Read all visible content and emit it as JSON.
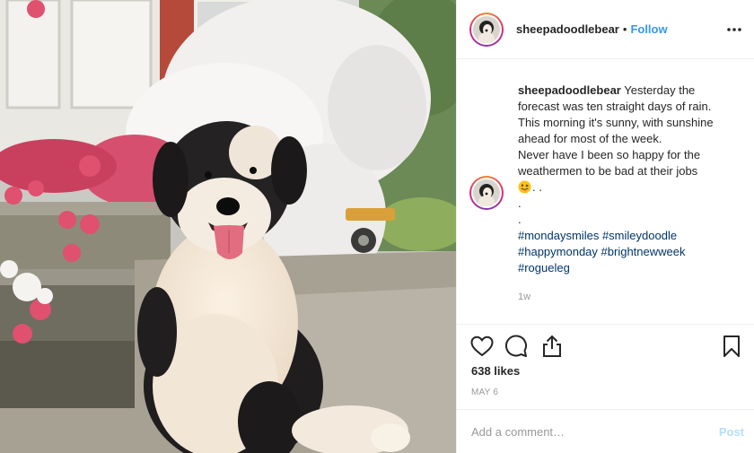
{
  "photo": {
    "alt_icon": "dog-photo"
  },
  "header": {
    "username": "sheepadoodlebear",
    "separator": "•",
    "follow_label": "Follow",
    "more_icon": "more-horizontal-icon"
  },
  "caption": {
    "username": "sheepadoodlebear",
    "lines": [
      " Yesterday the",
      "forecast was ten straight days of rain.",
      "This morning it's sunny, with sunshine",
      "ahead for most of the week.",
      "Never have I been so happy for the",
      "weathermen to be bad at their jobs"
    ],
    "emoji_suffix": ". .",
    "dots": [
      ".",
      "."
    ],
    "hashtags_line1": [
      "#mondaysmiles",
      "#smileydoodle"
    ],
    "hashtags_line2": [
      "#happymonday",
      "#brightnewweek"
    ],
    "hashtags_line3": [
      "#rogueleg"
    ],
    "time": "1w"
  },
  "actions": {
    "icons": [
      "heart-icon",
      "comment-icon",
      "share-icon",
      "bookmark-icon"
    ],
    "likes": "638 likes",
    "date": "MAY 6"
  },
  "comment_box": {
    "placeholder": "Add a comment…",
    "post_label": "Post"
  },
  "colors": {
    "accent": "#3897f0",
    "hashtag": "#003569",
    "muted": "#999999",
    "post_disabled": "#b2dffc"
  }
}
